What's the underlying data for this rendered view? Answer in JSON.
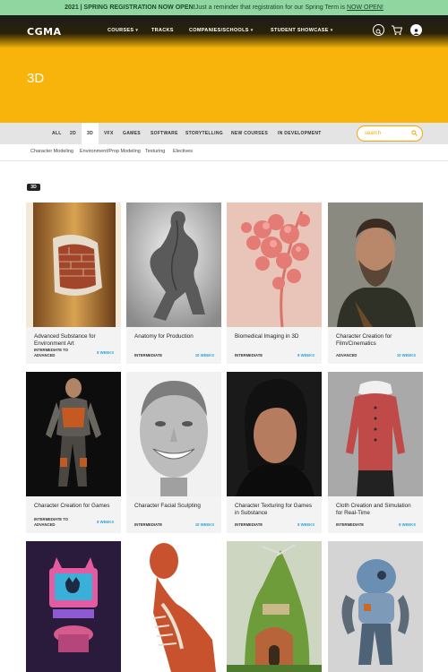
{
  "announcement": {
    "bold": "2021 | SPRING REGISTRATION NOW OPEN!",
    "text": "Just a reminder that registration for our Spring Term is ",
    "link": "NOW OPEN!"
  },
  "header": {
    "logo": "CGMA",
    "nav": [
      {
        "label": "COURSES",
        "dropdown": true
      },
      {
        "label": "TRACKS",
        "dropdown": false
      },
      {
        "label": "COMPANIES/SCHOOLS",
        "dropdown": true
      },
      {
        "label": "STUDENT SHOWCASE",
        "dropdown": true
      }
    ],
    "icons": [
      "search-icon",
      "cart-icon",
      "user-icon"
    ]
  },
  "page": {
    "title": "3D",
    "tag": "3D"
  },
  "categories": [
    "ALL",
    "2D",
    "3D",
    "VFX",
    "GAMES",
    "SOFTWARE",
    "STORYTELLING",
    "NEW COURSES",
    "IN DEVELOPMENT"
  ],
  "active_category": "3D",
  "search": {
    "placeholder": "search"
  },
  "subcategories": [
    "Character Modeling",
    "Environment/Prop Modeling",
    "Texturing",
    "Electives"
  ],
  "courses": [
    {
      "title": "Advanced Substance for Environment Art",
      "level": "INTERMEDIATE TO ADVANCED",
      "weeks": "8 WEEKS"
    },
    {
      "title": "Anatomy for Production",
      "level": "INTERMEDIATE",
      "weeks": "10 WEEKS"
    },
    {
      "title": "Biomedical Imaging in 3D",
      "level": "INTERMEDIATE",
      "weeks": "8 WEEKS"
    },
    {
      "title": "Character Creation for Film/Cinematics",
      "level": "ADVANCED",
      "weeks": "10 WEEKS"
    },
    {
      "title": "Character Creation for Games",
      "level": "INTERMEDIATE TO ADVANCED",
      "weeks": "8 WEEKS"
    },
    {
      "title": "Character Facial Sculpting",
      "level": "INTERMEDIATE",
      "weeks": "10 WEEKS"
    },
    {
      "title": "Character Texturing for Games in Substance",
      "level": "INTERMEDIATE",
      "weeks": "8 WEEKS"
    },
    {
      "title": "Cloth Creation and Simulation for Real-Time",
      "level": "INTERMEDIATE",
      "weeks": "8 WEEKS"
    }
  ],
  "colors": {
    "accent": "#f8b40a",
    "announce_bg": "#8fd6a0",
    "weeks": "#2a9fd6"
  }
}
